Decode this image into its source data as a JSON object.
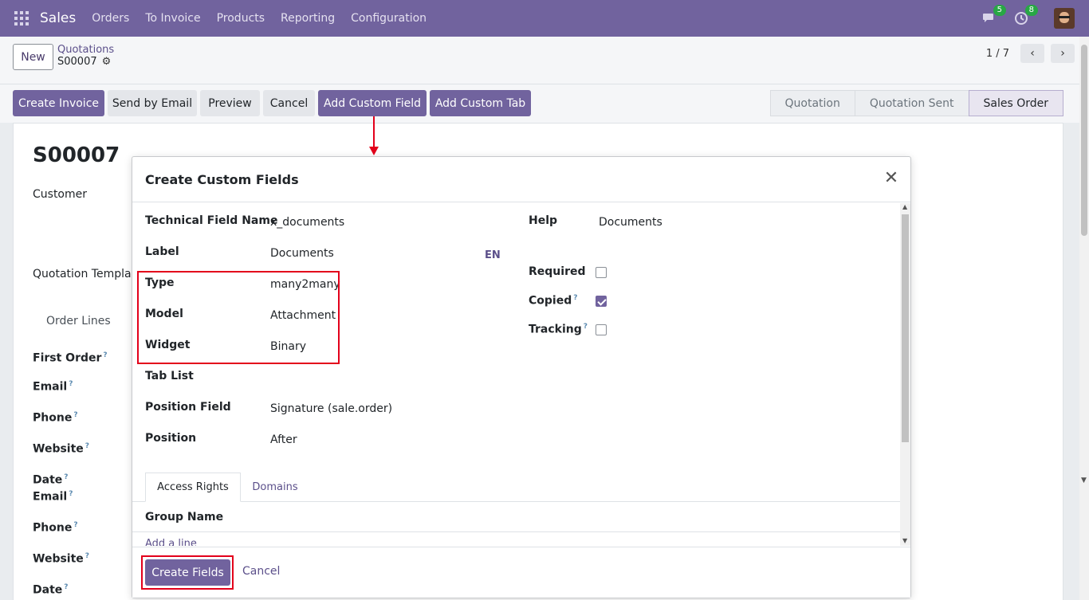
{
  "navbar": {
    "app_name": "Sales",
    "menu": [
      "Orders",
      "To Invoice",
      "Products",
      "Reporting",
      "Configuration"
    ],
    "messages_count": "5",
    "activities_count": "8"
  },
  "control_panel": {
    "new_label": "New",
    "breadcrumb_parent": "Quotations",
    "breadcrumb_current": "S00007",
    "pager": "1 / 7"
  },
  "actions": {
    "create_invoice": "Create Invoice",
    "send_by_email": "Send by Email",
    "preview": "Preview",
    "cancel": "Cancel",
    "add_custom_field": "Add Custom Field",
    "add_custom_tab": "Add Custom Tab"
  },
  "statusbar": [
    "Quotation",
    "Quotation Sent",
    "Sales Order"
  ],
  "background_form": {
    "title": "S00007",
    "customer_label": "Customer",
    "quotation_template_label": "Quotation Templat",
    "order_lines_tab": "Order Lines",
    "fields": [
      "First Order",
      "Email",
      "Phone",
      "Website",
      "Date",
      "Email",
      "Phone",
      "Website",
      "Date"
    ],
    "tip": "?"
  },
  "modal": {
    "title": "Create Custom Fields",
    "close_glyph": "✕",
    "fields": {
      "technical_name_label": "Technical Field Name",
      "technical_name_value": "x_documents",
      "label_label": "Label",
      "label_value": "Documents",
      "type_label": "Type",
      "type_value": "many2many",
      "model_label": "Model",
      "model_value": "Attachment",
      "widget_label": "Widget",
      "widget_value": "Binary",
      "tab_list_label": "Tab List",
      "position_field_label": "Position Field",
      "position_field_value": "Signature (sale.order)",
      "position_label": "Position",
      "position_value": "After",
      "lang": "EN"
    },
    "right": {
      "help_label": "Help",
      "help_value": "Documents",
      "required_label": "Required",
      "required_checked": false,
      "copied_label": "Copied",
      "copied_checked": true,
      "tracking_label": "Tracking",
      "tracking_checked": false,
      "tip": "?"
    },
    "tabs": [
      "Access Rights",
      "Domains"
    ],
    "group_name_header": "Group Name",
    "add_line": "Add a line",
    "footer": {
      "create_label": "Create Fields",
      "cancel_label": "Cancel"
    }
  },
  "colors": {
    "brand": "#71639e",
    "highlight": "#e3001b",
    "badge": "#28a745"
  }
}
